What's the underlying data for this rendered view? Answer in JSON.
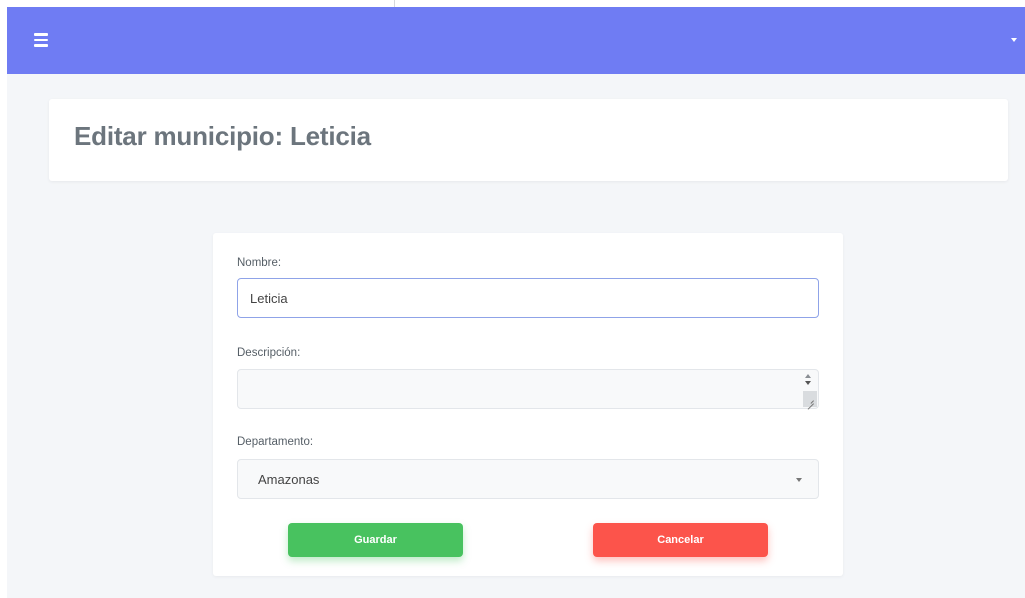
{
  "header": {
    "menu_icon": "hamburger-icon",
    "dropdown_icon": "caret-down-icon",
    "navbar_color": "#6f7cf3"
  },
  "page": {
    "title": "Editar municipio: Leticia"
  },
  "form": {
    "nombre": {
      "label": "Nombre:",
      "value": "Leticia"
    },
    "descripcion": {
      "label": "Descripción:",
      "value": ""
    },
    "departamento": {
      "label": "Departamento:",
      "selected": "Amazonas"
    },
    "buttons": {
      "guardar": {
        "label": "Guardar",
        "color": "#48c25f"
      },
      "cancelar": {
        "label": "Cancelar",
        "color": "#fc544b"
      }
    }
  }
}
